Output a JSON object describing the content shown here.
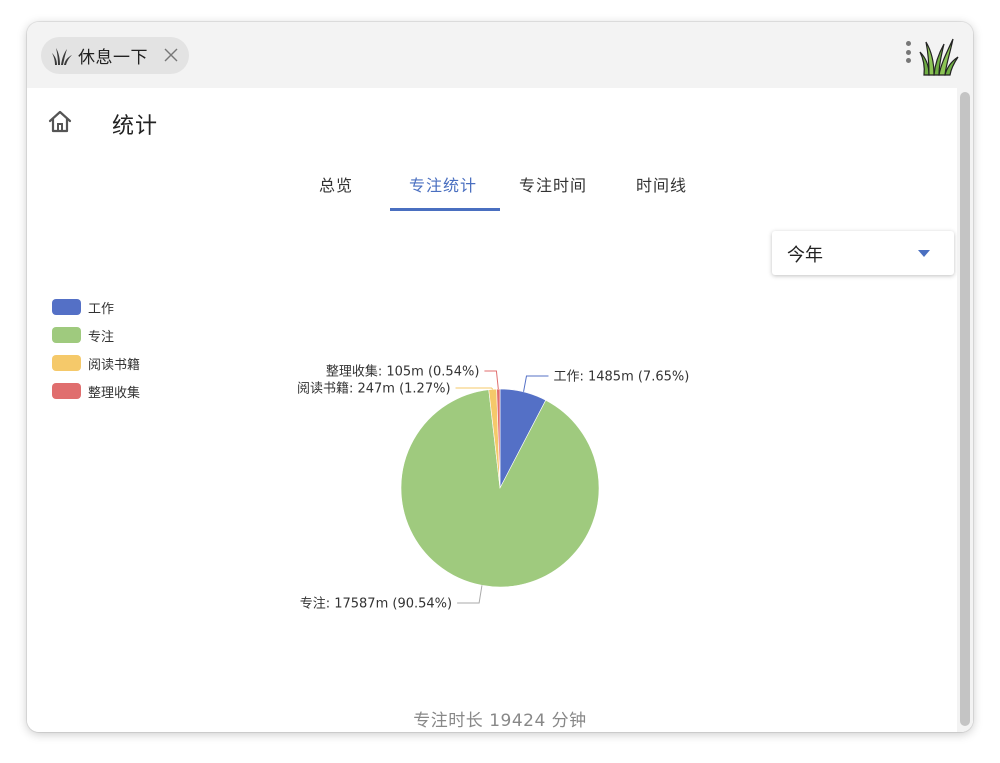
{
  "titlebar": {
    "chip_label": "休息一下",
    "chip_icon": "grass-icon",
    "close_icon": "close-icon",
    "menu_icon": "more-vertical-icon",
    "logo_icon": "grass-logo-icon"
  },
  "header": {
    "home_icon": "home-icon",
    "title": "统计"
  },
  "tabs": [
    {
      "label": "总览",
      "active": false
    },
    {
      "label": "专注统计",
      "active": true
    },
    {
      "label": "专注时间",
      "active": false
    },
    {
      "label": "时间线",
      "active": false
    }
  ],
  "period_select": {
    "value": "今年",
    "caret_icon": "caret-down-icon"
  },
  "colors": {
    "accent": "#4a6fc0",
    "work": "#5470c6",
    "focus": "#9fca7e",
    "reading": "#f5c96a",
    "organize": "#e06e6e"
  },
  "chart_data": {
    "type": "pie",
    "legend_position": "left",
    "slices": [
      {
        "name": "工作",
        "value": 1485,
        "percent": 7.65,
        "label": "工作: 1485m (7.65%)",
        "color": "#5470c6"
      },
      {
        "name": "专注",
        "value": 17587,
        "percent": 90.54,
        "label": "专注: 17587m (90.54%)",
        "color": "#9fca7e"
      },
      {
        "name": "阅读书籍",
        "value": 247,
        "percent": 1.27,
        "label": "阅读书籍: 247m (1.27%)",
        "color": "#f5c96a"
      },
      {
        "name": "整理收集",
        "value": 105,
        "percent": 0.54,
        "label": "整理收集: 105m (0.54%)",
        "color": "#e06e6e"
      }
    ]
  },
  "summary": "专注时长 19424 分钟"
}
